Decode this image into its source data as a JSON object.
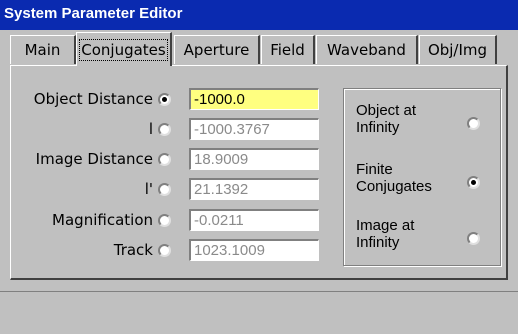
{
  "window": {
    "title": "System Parameter Editor"
  },
  "tabs": [
    {
      "label": "Main"
    },
    {
      "label": "Conjugates"
    },
    {
      "label": "Aperture"
    },
    {
      "label": "Field"
    },
    {
      "label": "Waveband"
    },
    {
      "label": "Obj/Img"
    }
  ],
  "active_tab": "Conjugates",
  "parameters": [
    {
      "label": "Object Distance",
      "value": "-1000.0",
      "selected": true
    },
    {
      "label": "l",
      "value": "-1000.3767",
      "selected": false
    },
    {
      "label": "Image Distance",
      "value": "18.9009",
      "selected": false
    },
    {
      "label": "l'",
      "value": "21.1392",
      "selected": false
    },
    {
      "label": "Magnification",
      "value": "-0.0211",
      "selected": false
    },
    {
      "label": "Track",
      "value": "1023.1009",
      "selected": false
    }
  ],
  "conjugate_options": [
    {
      "label_line1": "Object at",
      "label_line2": "Infinity",
      "selected": false
    },
    {
      "label_line1": "Finite",
      "label_line2": "Conjugates",
      "selected": true
    },
    {
      "label_line1": "Image at",
      "label_line2": "Infinity",
      "selected": false
    }
  ],
  "colors": {
    "titlebar": "#0a2ab0",
    "active_field": "#ffff80",
    "window_bg": "#c0c0c0"
  }
}
